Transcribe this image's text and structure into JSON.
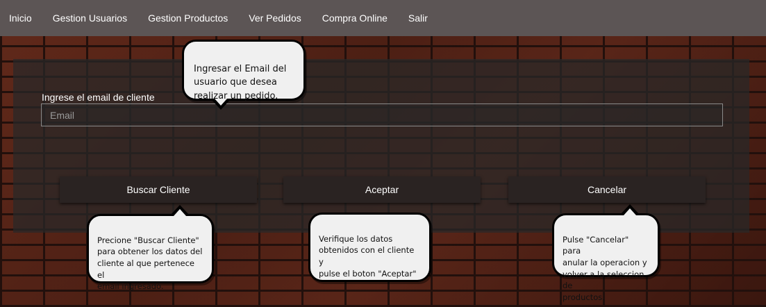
{
  "nav": {
    "items": [
      {
        "label": "Inicio"
      },
      {
        "label": "Gestion Usuarios"
      },
      {
        "label": "Gestion Productos"
      },
      {
        "label": "Ver Pedidos"
      },
      {
        "label": "Compra Online"
      },
      {
        "label": "Salir"
      }
    ]
  },
  "form": {
    "email_label": "Ingrese el email de cliente",
    "email_placeholder": "Email",
    "email_value": ""
  },
  "buttons": {
    "buscar": "Buscar Cliente",
    "aceptar": "Aceptar",
    "cancelar": "Cancelar"
  },
  "tooltips": {
    "email": "Ingresar el Email del\nusuario que desea\nrealizar un pedido.",
    "buscar": "Precione \"Buscar Cliente\"\npara obtener los datos del\ncliente al que pertenece el\nemail  ingresado.",
    "aceptar": "Verifique los datos\nobtenidos con el cliente y\npulse el boton \"Aceptar\"\npara seguir con la compra",
    "cancelar": "Pulse \"Cancelar\" para\nanular la operacion y\nvolver a la seleccion de\nproductos."
  }
}
